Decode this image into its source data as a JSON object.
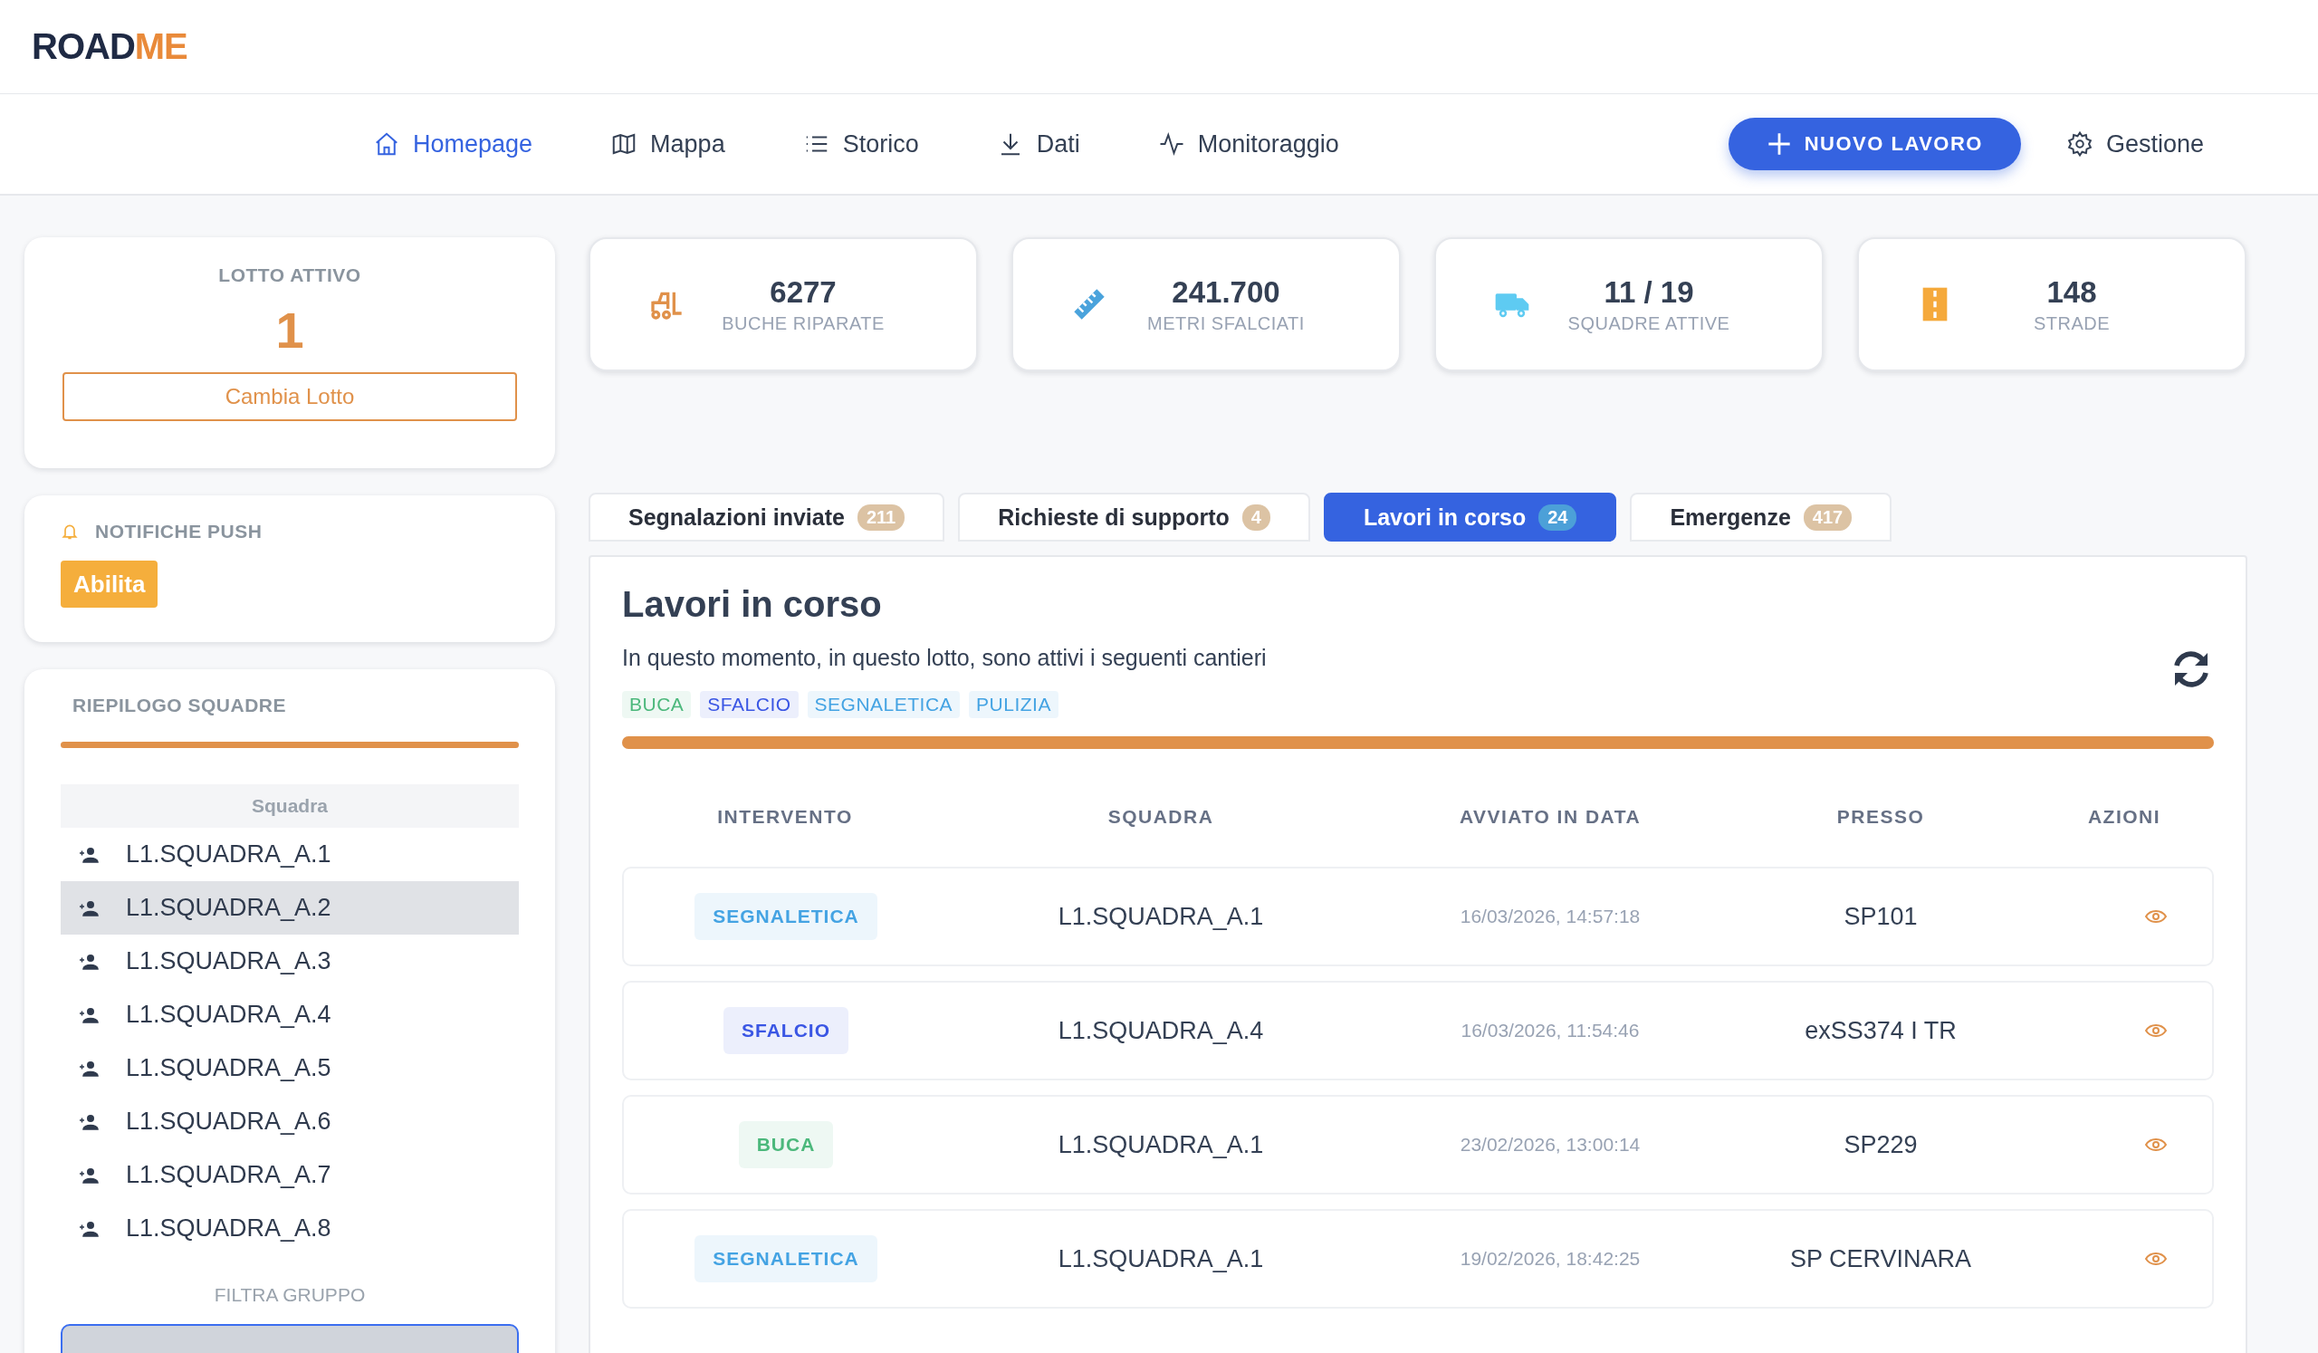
{
  "logo": {
    "main": "ROAD",
    "accent": "ME"
  },
  "nav": {
    "items": [
      {
        "label": "Homepage",
        "selected": true
      },
      {
        "label": "Mappa",
        "selected": false
      },
      {
        "label": "Storico",
        "selected": false
      },
      {
        "label": "Dati",
        "selected": false
      },
      {
        "label": "Monitoraggio",
        "selected": false
      }
    ],
    "new_button": "NUOVO LAVORO",
    "settings": "Gestione"
  },
  "lotto": {
    "title": "LOTTO ATTIVO",
    "value": "1",
    "button": "Cambia Lotto"
  },
  "notifications": {
    "title": "NOTIFICHE PUSH",
    "button": "Abilita"
  },
  "teams": {
    "title": "RIEPILOGO SQUADRE",
    "column": "Squadra",
    "items": [
      {
        "name": "L1.SQUADRA_A.1",
        "selected": false
      },
      {
        "name": "L1.SQUADRA_A.2",
        "selected": true
      },
      {
        "name": "L1.SQUADRA_A.3",
        "selected": false
      },
      {
        "name": "L1.SQUADRA_A.4",
        "selected": false
      },
      {
        "name": "L1.SQUADRA_A.5",
        "selected": false
      },
      {
        "name": "L1.SQUADRA_A.6",
        "selected": false
      },
      {
        "name": "L1.SQUADRA_A.7",
        "selected": false
      },
      {
        "name": "L1.SQUADRA_A.8",
        "selected": false
      }
    ],
    "filter_label": "FILTRA GRUPPO",
    "loading": {
      "level": 1
    }
  },
  "stats": [
    {
      "value": "6277",
      "label": "BUCHE RIPARATE"
    },
    {
      "value": "241.700",
      "label": "METRI SFALCIATI"
    },
    {
      "value": "11 / 19",
      "label": "SQUADRE ATTIVE"
    },
    {
      "value": "148",
      "label": "STRADE"
    }
  ],
  "tabs": [
    {
      "label": "Segnalazioni inviate",
      "count": "211",
      "selected": false
    },
    {
      "label": "Richieste di supporto",
      "count": "4",
      "selected": false
    },
    {
      "label": "Lavori in corso",
      "count": "24",
      "selected": true
    },
    {
      "label": "Emergenze",
      "count": "417",
      "selected": false
    }
  ],
  "panel": {
    "title": "Lavori in corso",
    "loading": {
      "level": 1
    },
    "subtitle": "In questo momento, in questo lotto, sono attivi i seguenti cantieri",
    "tags": [
      {
        "label": "BUCA",
        "color": "#4cb87c"
      },
      {
        "label": "SFALCIO",
        "color": "#3a56e4"
      },
      {
        "label": "SEGNALETICA",
        "color": "#44a3e3"
      },
      {
        "label": "PULIZIA",
        "color": "#44a3e3"
      }
    ],
    "columns": [
      "INTERVENTO",
      "SQUADRA",
      "AVVIATO IN DATA",
      "PRESSO",
      "AZIONI"
    ],
    "rows": [
      {
        "type": "SEGNALETICA",
        "color": "#44a3e3",
        "team": "L1.SQUADRA_A.1",
        "date": "16/03/2026, 14:57:18",
        "place": "SP101"
      },
      {
        "type": "SFALCIO",
        "color": "#3a56e4",
        "team": "L1.SQUADRA_A.4",
        "date": "16/03/2026, 11:54:46",
        "place": "exSS374 I TR"
      },
      {
        "type": "BUCA",
        "color": "#4cb87c",
        "team": "L1.SQUADRA_A.1",
        "date": "23/02/2026, 13:00:14",
        "place": "SP229"
      },
      {
        "type": "SEGNALETICA",
        "color": "#44a3e3",
        "team": "L1.SQUADRA_A.1",
        "date": "19/02/2026, 18:42:25",
        "place": "SP CERVINARA"
      }
    ]
  }
}
